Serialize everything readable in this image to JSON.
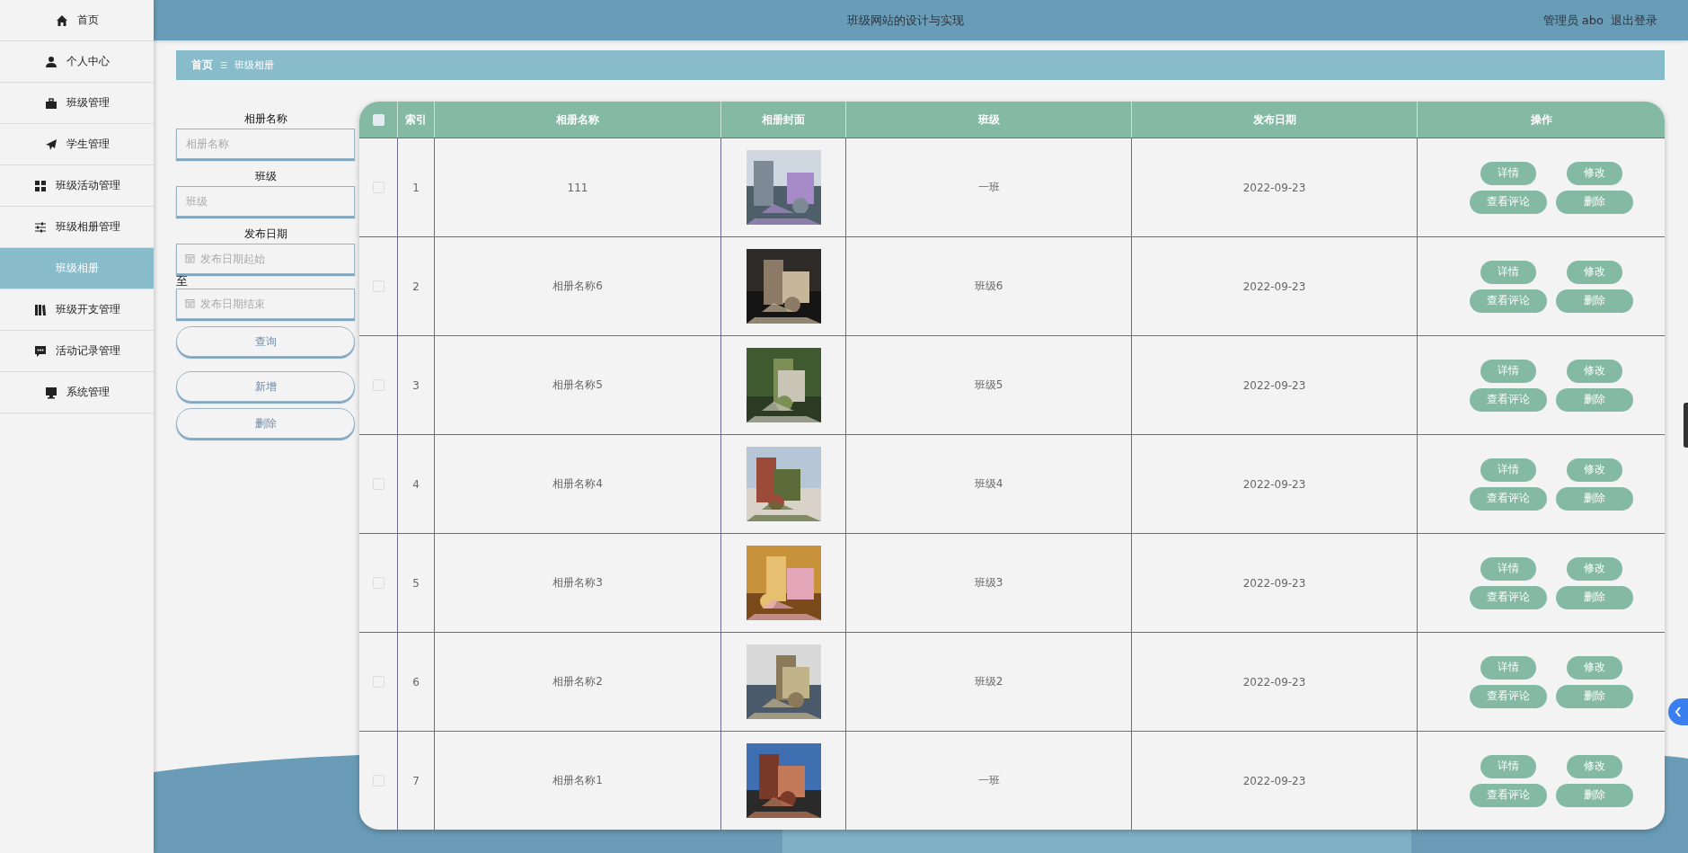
{
  "header": {
    "title": "班级网站的设计与实现",
    "user": "管理员 abo",
    "logout": "退出登录"
  },
  "sidebar": {
    "items": [
      {
        "label": "首页",
        "selected": false
      },
      {
        "label": "个人中心",
        "selected": false
      },
      {
        "label": "班级管理",
        "selected": false
      },
      {
        "label": "学生管理",
        "selected": false
      },
      {
        "label": "班级活动管理",
        "selected": false
      },
      {
        "label": "班级相册管理",
        "selected": false,
        "expanded": true,
        "children": [
          {
            "label": "班级相册",
            "selected": true
          }
        ]
      },
      {
        "label": "班级开支管理",
        "selected": false
      },
      {
        "label": "活动记录管理",
        "selected": false
      },
      {
        "label": "系统管理",
        "selected": false
      }
    ]
  },
  "breadcrumb": {
    "home": "首页",
    "separator": "☰",
    "current": "班级相册"
  },
  "search": {
    "fields": [
      {
        "kind": "text",
        "label": "相册名称",
        "placeholder": "相册名称"
      },
      {
        "kind": "text",
        "label": "班级",
        "placeholder": "班级"
      },
      {
        "kind": "daterange",
        "label": "发布日期",
        "placeholder": "发布日期起始",
        "joiner": "至",
        "placeholder_end": "发布日期结束"
      }
    ],
    "buttons": [
      {
        "label": "查询"
      },
      {
        "label": "新增"
      },
      {
        "label": "删除"
      }
    ]
  },
  "table": {
    "select_all": {
      "checked": false
    },
    "columns": [
      "索引",
      "相册名称",
      "相册封面",
      "班级",
      "发布日期",
      "操作"
    ],
    "rows": [
      {
        "checked": false,
        "index": "1",
        "name": "111",
        "class": "一班",
        "date": "2022-09-23",
        "actions": [
          "详情",
          "修改",
          "查看评论",
          "删除"
        ]
      },
      {
        "checked": false,
        "index": "2",
        "name": "相册名称6",
        "class": "班级6",
        "date": "2022-09-23",
        "actions": [
          "详情",
          "修改",
          "查看评论",
          "删除"
        ]
      },
      {
        "checked": false,
        "index": "3",
        "name": "相册名称5",
        "class": "班级5",
        "date": "2022-09-23",
        "actions": [
          "详情",
          "修改",
          "查看评论",
          "删除"
        ]
      },
      {
        "checked": false,
        "index": "4",
        "name": "相册名称4",
        "class": "班级4",
        "date": "2022-09-23",
        "actions": [
          "详情",
          "修改",
          "查看评论",
          "删除"
        ]
      },
      {
        "checked": false,
        "index": "5",
        "name": "相册名称3",
        "class": "班级3",
        "date": "2022-09-23",
        "actions": [
          "详情",
          "修改",
          "查看评论",
          "删除"
        ]
      },
      {
        "checked": false,
        "index": "6",
        "name": "相册名称2",
        "class": "班级2",
        "date": "2022-09-23",
        "actions": [
          "详情",
          "修改",
          "查看评论",
          "删除"
        ]
      },
      {
        "checked": false,
        "index": "7",
        "name": "相册名称1",
        "class": "一班",
        "date": "2022-09-23",
        "actions": [
          "详情",
          "修改",
          "查看评论",
          "删除"
        ]
      }
    ]
  }
}
